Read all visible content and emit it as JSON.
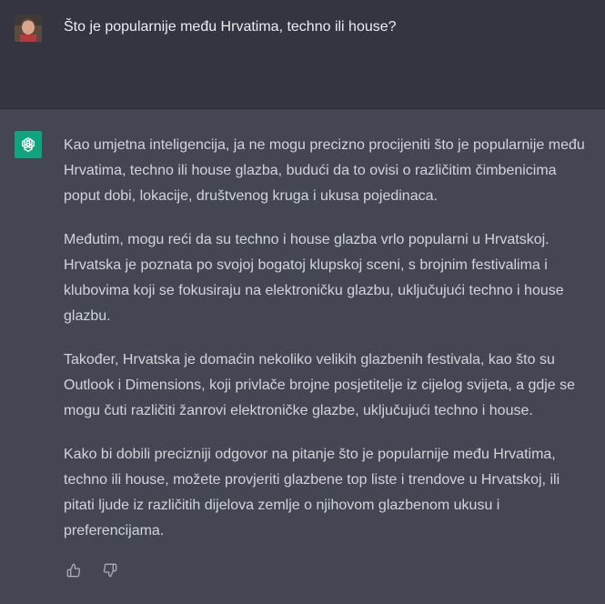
{
  "user": {
    "avatar_icon": "user-avatar-photo",
    "message": "Što je popularnije među Hrvatima, techno ili house?"
  },
  "assistant": {
    "avatar_icon": "openai-logo-icon",
    "accent_color": "#10a37f",
    "paragraphs": [
      "Kao umjetna inteligencija, ja ne mogu precizno procijeniti što je popularnije među Hrvatima, techno ili house glazba, budući da to ovisi o različitim čimbenicima poput dobi, lokacije, društvenog kruga i ukusa pojedinaca.",
      "Međutim, mogu reći da su techno i house glazba vrlo popularni u Hrvatskoj. Hrvatska je poznata po svojoj bogatoj klupskoj sceni, s brojnim festivalima i klubovima koji se fokusiraju na elektroničku glazbu, uključujući techno i house glazbu.",
      "Također, Hrvatska je domaćin nekoliko velikih glazbenih festivala, kao što su Outlook i Dimensions, koji privlače brojne posjetitelje iz cijelog svijeta, a gdje se mogu čuti različiti žanrovi elektroničke glazbe, uključujući techno i house.",
      "Kako bi dobili precizniji odgovor na pitanje što je popularnije među Hrvatima, techno ili house, možete provjeriti glazbene top liste i trendove u Hrvatskoj, ili pitati ljude iz različitih dijelova zemlje o njihovom glazbenom ukusu i preferencijama."
    ],
    "feedback": [
      "thumbs-up-icon",
      "thumbs-down-icon"
    ]
  }
}
